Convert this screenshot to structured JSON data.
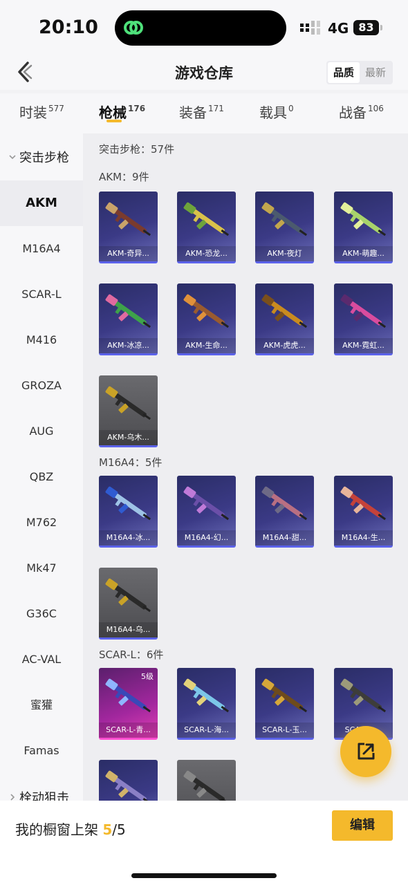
{
  "status": {
    "time": "20:10",
    "network": "4G",
    "battery": "83"
  },
  "nav": {
    "title": "游戏仓库",
    "sort": [
      "品质",
      "最新"
    ]
  },
  "tabs": [
    {
      "label": "时装",
      "count": "577"
    },
    {
      "label": "枪械",
      "count": "176"
    },
    {
      "label": "装备",
      "count": "171"
    },
    {
      "label": "载具",
      "count": "0"
    },
    {
      "label": "战备",
      "count": "106"
    }
  ],
  "sidebar": {
    "group": "突击步枪",
    "items": [
      "AKM",
      "M16A4",
      "SCAR-L",
      "M416",
      "GROZA",
      "AUG",
      "QBZ",
      "M762",
      "Mk47",
      "G36C",
      "AC-VAL",
      "蜜獾",
      "Famas"
    ],
    "next_group": "栓动狙击"
  },
  "main": {
    "total": "突击步枪：57件",
    "sections": [
      {
        "title": "AKM：9件",
        "items": [
          "AKM-奇异...",
          "AKM-恐龙...",
          "AKM-夜灯",
          "AKM-萌趣...",
          "AKM-冰凉...",
          "AKM-生命...",
          "AKM-虎虎...",
          "AKM-霓虹...",
          "AKM-乌木..."
        ]
      },
      {
        "title": "M16A4：5件",
        "items": [
          "M16A4-冰...",
          "M16A4-幻...",
          "M16A4-甜...",
          "M16A4-生...",
          "M16A4-乌..."
        ]
      },
      {
        "title": "SCAR-L：6件",
        "items": [
          "SCAR-L-青...",
          "SCAR-L-海...",
          "SCAR-L-玉...",
          "SCAR-L-...",
          "",
          ""
        ],
        "first_badge": "5级"
      }
    ]
  },
  "bottom": {
    "label": "我的橱窗上架",
    "current": "5",
    "total": "/5",
    "edit": "编辑"
  },
  "colors": {
    "accent": "#f4b92c",
    "card": "#3b3a86",
    "card_border": "#5b62ea",
    "pink": "#e13fb4"
  },
  "icons": [
    "back-icon",
    "chevron-down-icon",
    "chevron-right-icon",
    "share-icon",
    "app-link-icon",
    "signal-icon",
    "rifle-icon"
  ]
}
